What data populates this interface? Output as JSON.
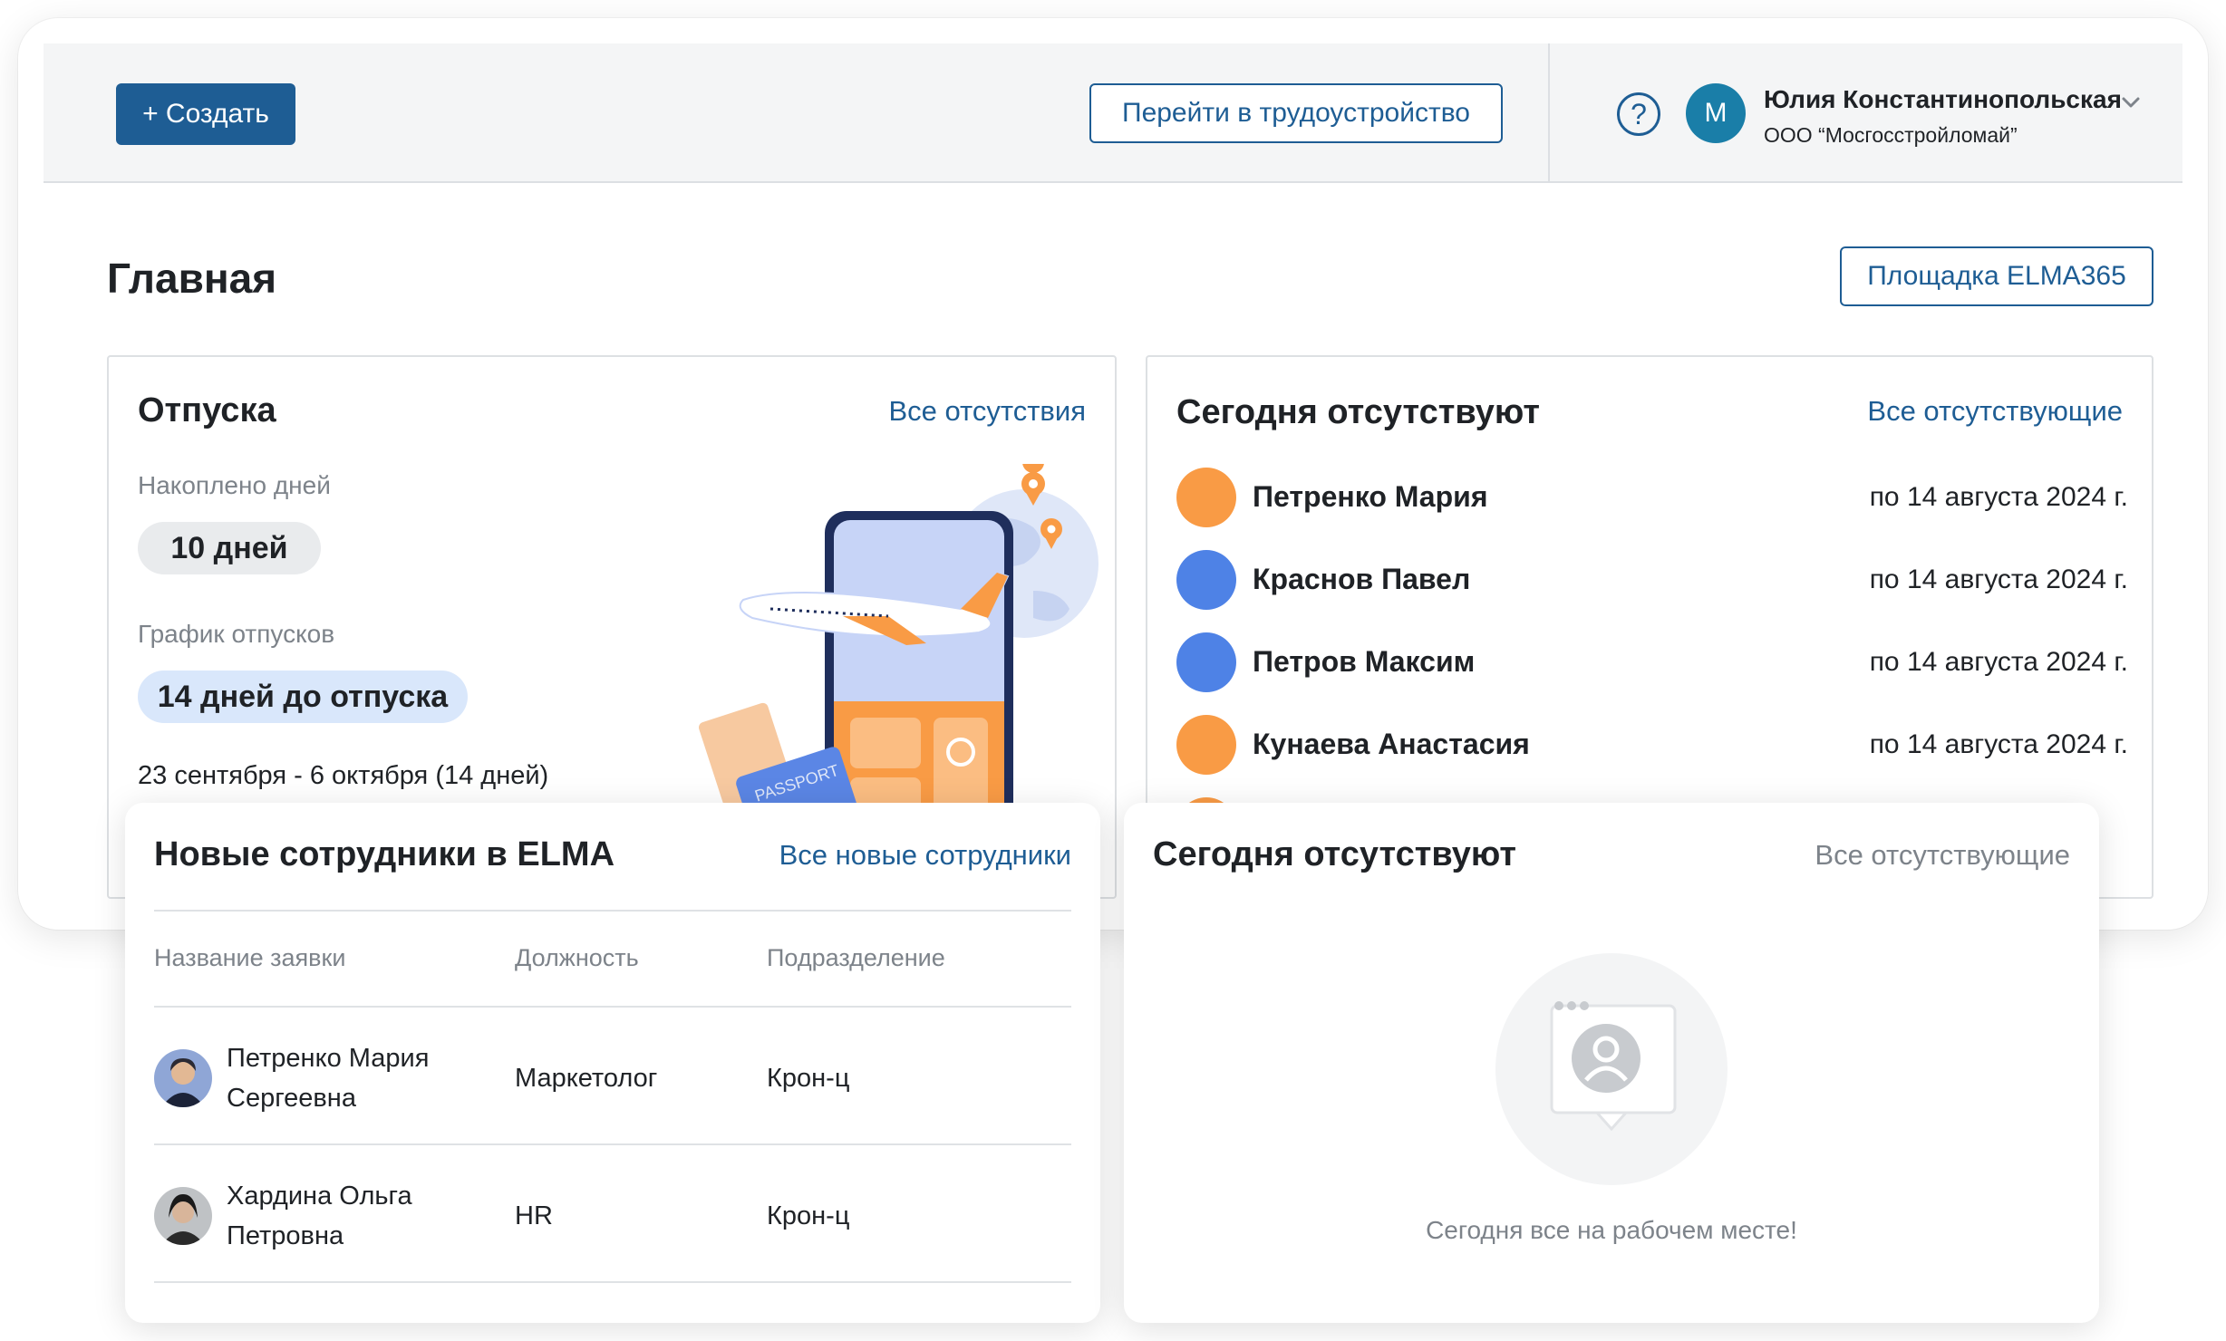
{
  "header": {
    "create_label": "+ Создать",
    "employ_label": "Перейти в трудоустройство",
    "help_glyph": "?",
    "user": {
      "initial": "М",
      "name": "Юлия Константинопольская",
      "org": "ООО “Мосгосстройломай”"
    }
  },
  "page": {
    "title": "Главная",
    "platform_label": "Площадка ELMA365"
  },
  "vacations": {
    "title": "Отпуска",
    "link": "Все отсутствия",
    "accrued_label": "Накоплено дней",
    "accrued_value": "10 дней",
    "schedule_label": "График отпусков",
    "days_until": "14 дней до отпуска",
    "period": "23 сентября - 6 октября (14 дней)",
    "passport_text": "PASSPORT"
  },
  "absent": {
    "title": "Сегодня отсутствуют",
    "link": "Все отсутствующие",
    "rows": [
      {
        "name": "Петренко Мария",
        "date": "по 14 августа 2024 г.",
        "color": "#f99b45"
      },
      {
        "name": "Краснов Павел",
        "date": "по 14 августа 2024 г.",
        "color": "#4e82e6"
      },
      {
        "name": "Петров Максим",
        "date": "по 14 августа 2024 г.",
        "color": "#4e82e6"
      },
      {
        "name": "Кунаева Анастасия",
        "date": "по 14 августа 2024 г.",
        "color": "#f99b45"
      }
    ]
  },
  "new_employees": {
    "title": "Новые сотрудники в ELMA",
    "link": "Все новые сотрудники",
    "columns": [
      "Название заявки",
      "Должность",
      "Подразделение"
    ],
    "rows": [
      {
        "name_line1": "Петренко Мария",
        "name_line2": "Сергеевна",
        "position": "Маркетолог",
        "department": "Крон-ц"
      },
      {
        "name_line1": "Хардина Ольга",
        "name_line2": "Петровна",
        "position": "HR",
        "department": "Крон-ц"
      }
    ]
  },
  "absent_empty": {
    "title": "Сегодня отсутствуют",
    "link": "Все отсутствующие",
    "empty_message": "Сегодня все на рабочем месте!"
  },
  "colors": {
    "primary": "#1e5d94",
    "orange": "#f99b45",
    "blue": "#4e82e6"
  }
}
